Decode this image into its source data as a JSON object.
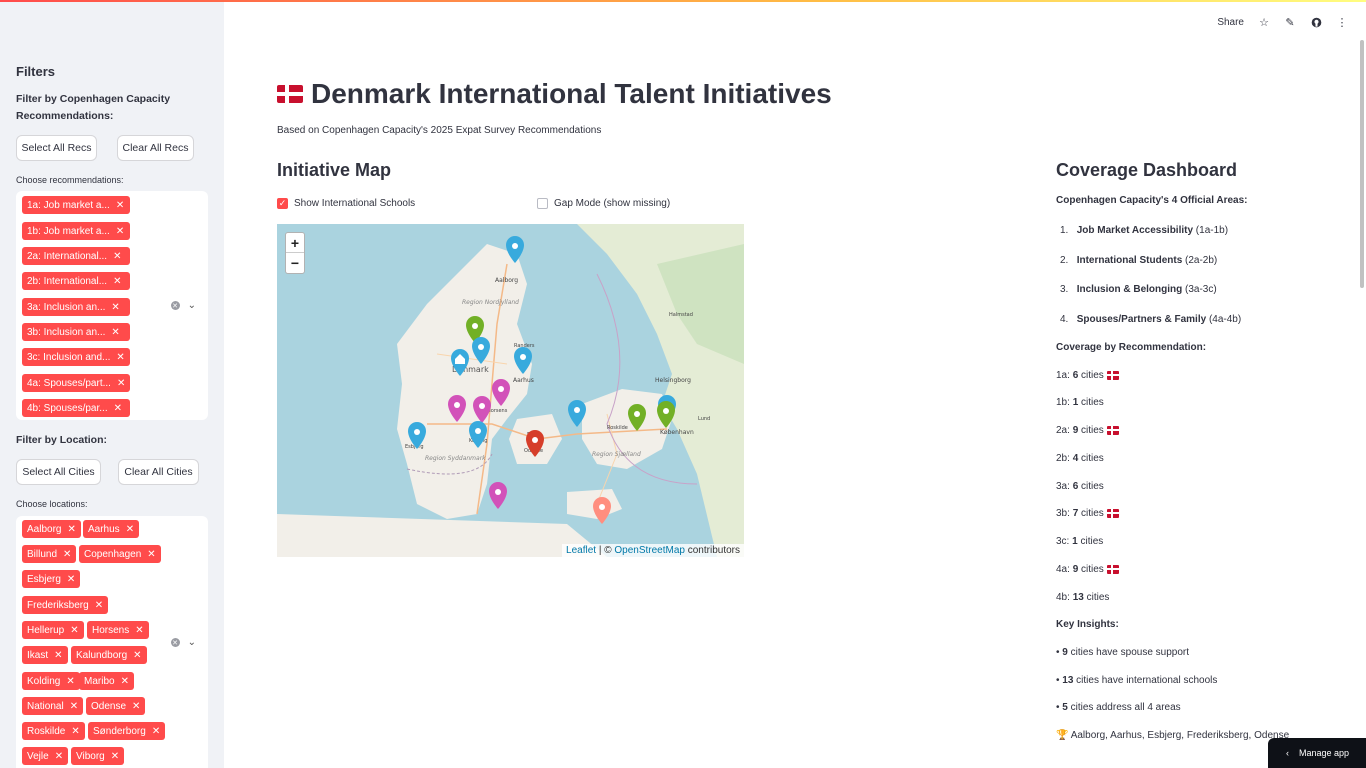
{
  "header": {
    "share_label": "Share",
    "icons": [
      "star-icon",
      "edit-icon",
      "github-icon",
      "more-icon"
    ]
  },
  "sidebar": {
    "title": "Filters",
    "rec_filter_label": "Filter by Copenhagen Capacity Recommendations:",
    "select_all_recs": "Select All Recs",
    "clear_all_recs": "Clear All Recs",
    "choose_recs_label": "Choose recommendations:",
    "rec_chips": [
      "1a: Job market a...",
      "1b: Job market a...",
      "2a: International...",
      "2b: International...",
      "3a: Inclusion an...",
      "3b: Inclusion an...",
      "3c: Inclusion and...",
      "4a: Spouses/part...",
      "4b: Spouses/par..."
    ],
    "loc_filter_label": "Filter by Location:",
    "select_all_cities": "Select All Cities",
    "clear_all_cities": "Clear All Cities",
    "choose_locs_label": "Choose locations:",
    "loc_chips": [
      "Aalborg",
      "Aarhus",
      "Billund",
      "Copenhagen",
      "Esbjerg",
      "Frederiksberg",
      "Hellerup",
      "Horsens",
      "Ikast",
      "Kalundborg",
      "Kolding",
      "Maribo",
      "National",
      "Odense",
      "Roskilde",
      "Sønderborg",
      "Vejle",
      "Viborg"
    ]
  },
  "main": {
    "title": "Denmark International Talent Initiatives",
    "subtitle": "Based on Copenhagen Capacity's 2025 Expat Survey Recommendations",
    "map_heading": "Initiative Map",
    "show_schools_label": "Show International Schools",
    "show_schools_checked": true,
    "gap_mode_label": "Gap Mode (show missing)",
    "gap_mode_checked": false
  },
  "map": {
    "zoom_in": "+",
    "zoom_out": "−",
    "attribution_leaflet": "Leaflet",
    "attribution_sep": " | © ",
    "attribution_osm": "OpenStreetMap",
    "attribution_tail": " contributors",
    "place_labels": [
      "Aalborg",
      "Region Nordjylland",
      "Danmark",
      "Randers",
      "Aarhus",
      "Horsens",
      "Region Syddanmark",
      "Odense",
      "Fyn",
      "Region Sjælland",
      "Roskilde",
      "København",
      "Helsingborg",
      "Lund",
      "Halmstad",
      "Esbjerg",
      "Kolding"
    ],
    "marker_colors": {
      "blue": "#38aadd",
      "green": "#72b026",
      "purple": "#d252b9",
      "red": "#d63e2a",
      "salmon": "#ff8e7f"
    }
  },
  "dashboard": {
    "heading": "Coverage Dashboard",
    "areas_title": "Copenhagen Capacity's 4 Official Areas:",
    "areas": [
      {
        "num": "1.",
        "name": "Job Market Accessibility",
        "range": " (1a-1b)"
      },
      {
        "num": "2.",
        "name": "International Students",
        "range": " (2a-2b)"
      },
      {
        "num": "3.",
        "name": "Inclusion & Belonging",
        "range": " (3a-3c)"
      },
      {
        "num": "4.",
        "name": "Spouses/Partners & Family",
        "range": " (4a-4b)"
      }
    ],
    "coverage_title": "Coverage by Recommendation:",
    "coverage": [
      {
        "code": "1a: ",
        "count": "6",
        "unit": " cities",
        "flag": true
      },
      {
        "code": "1b: ",
        "count": "1",
        "unit": " cities",
        "flag": false
      },
      {
        "code": "2a: ",
        "count": "9",
        "unit": " cities",
        "flag": true
      },
      {
        "code": "2b: ",
        "count": "4",
        "unit": " cities",
        "flag": false
      },
      {
        "code": "3a: ",
        "count": "6",
        "unit": " cities",
        "flag": false
      },
      {
        "code": "3b: ",
        "count": "7",
        "unit": " cities",
        "flag": true
      },
      {
        "code": "3c: ",
        "count": "1",
        "unit": " cities",
        "flag": false
      },
      {
        "code": "4a: ",
        "count": "9",
        "unit": " cities",
        "flag": true
      },
      {
        "code": "4b: ",
        "count": "13",
        "unit": " cities",
        "flag": false
      }
    ],
    "insights_title": "Key Insights:",
    "insights": [
      {
        "bullet": "• ",
        "count": "9",
        "text": " cities have spouse support"
      },
      {
        "bullet": "• ",
        "count": "13",
        "text": " cities have international schools"
      },
      {
        "bullet": "• ",
        "count": "5",
        "text": " cities address all 4 areas"
      }
    ],
    "top_cities": "Aalborg, Aarhus, Esbjerg, Frederiksberg, Odense"
  },
  "manage_app": "Manage app"
}
